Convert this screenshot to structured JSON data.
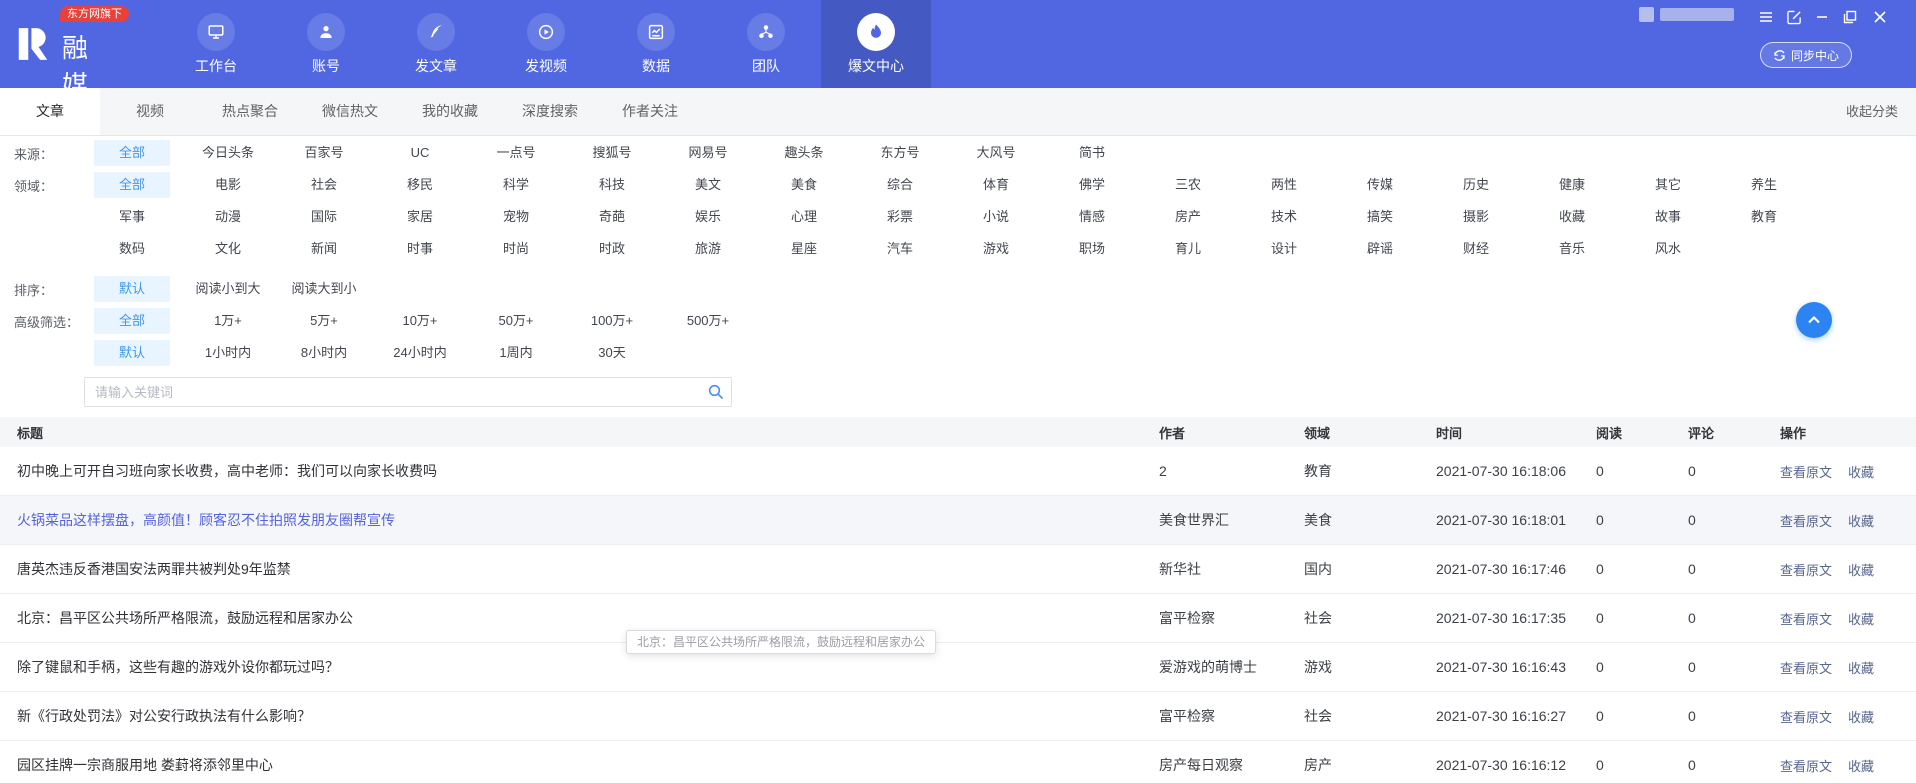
{
  "topbar": {
    "badge": "东方网旗下",
    "brand": "融媒宝",
    "nav": [
      {
        "label": "工作台"
      },
      {
        "label": "账号"
      },
      {
        "label": "发文章"
      },
      {
        "label": "发视频"
      },
      {
        "label": "数据"
      },
      {
        "label": "团队"
      },
      {
        "label": "爆文中心",
        "active": true
      }
    ],
    "sync_button": "同步中心"
  },
  "tabbar": {
    "tabs": [
      "文章",
      "视频",
      "热点聚合",
      "微信热文",
      "我的收藏",
      "深度搜索",
      "作者关注"
    ],
    "active_tab": "文章",
    "collapse": "收起分类"
  },
  "filters": {
    "source": {
      "label": "来源：",
      "selected": "全部",
      "options": [
        "全部",
        "今日头条",
        "百家号",
        "UC",
        "一点号",
        "搜狐号",
        "网易号",
        "趣头条",
        "东方号",
        "大风号",
        "简书"
      ]
    },
    "domain": {
      "label": "领域：",
      "selected": "全部",
      "rows": [
        [
          "全部",
          "电影",
          "社会",
          "移民",
          "科学",
          "科技",
          "美文",
          "美食",
          "综合",
          "体育",
          "佛学",
          "三农",
          "两性",
          "传媒",
          "历史",
          "健康",
          "其它",
          "养生"
        ],
        [
          "军事",
          "动漫",
          "国际",
          "家居",
          "宠物",
          "奇葩",
          "娱乐",
          "心理",
          "彩票",
          "小说",
          "情感",
          "房产",
          "技术",
          "搞笑",
          "摄影",
          "收藏",
          "故事",
          "教育"
        ],
        [
          "数码",
          "文化",
          "新闻",
          "时事",
          "时尚",
          "时政",
          "旅游",
          "星座",
          "汽车",
          "游戏",
          "职场",
          "育儿",
          "设计",
          "辟谣",
          "财经",
          "音乐",
          "风水"
        ]
      ]
    },
    "sort": {
      "label": "排序：",
      "selected": "默认",
      "options": [
        "默认",
        "阅读小到大",
        "阅读大到小"
      ]
    },
    "advanced": {
      "label": "高级筛选：",
      "read_selected": "全部",
      "read_options": [
        "全部",
        "1万+",
        "5万+",
        "10万+",
        "50万+",
        "100万+",
        "500万+"
      ],
      "time_selected": "默认",
      "time_options": [
        "默认",
        "1小时内",
        "8小时内",
        "24小时内",
        "1周内",
        "30天"
      ]
    },
    "search": {
      "placeholder": "请输入关键词"
    }
  },
  "table": {
    "headers": {
      "title": "标题",
      "author": "作者",
      "domain": "领域",
      "time": "时间",
      "reads": "阅读",
      "comments": "评论",
      "actions": "操作"
    },
    "row_actions": {
      "view": "查看原文",
      "fav": "收藏"
    },
    "rows": [
      {
        "title": "初中晚上可开自习班向家长收费，高中老师：我们可以向家长收费吗",
        "author": "2",
        "domain": "教育",
        "time": "2021-07-30 16:18:06",
        "reads": "0",
        "comments": "0"
      },
      {
        "title": "火锅菜品这样摆盘，高颜值！顾客忍不住拍照发朋友圈帮宣传",
        "author": "美食世界汇",
        "domain": "美食",
        "time": "2021-07-30 16:18:01",
        "reads": "0",
        "comments": "0",
        "blue": true,
        "hl": true
      },
      {
        "title": "唐英杰违反香港国安法两罪共被判处9年监禁",
        "author": "新华社",
        "domain": "国内",
        "time": "2021-07-30 16:17:46",
        "reads": "0",
        "comments": "0"
      },
      {
        "title": "北京：昌平区公共场所严格限流，鼓励远程和居家办公",
        "author": "富平检察",
        "domain": "社会",
        "time": "2021-07-30 16:17:35",
        "reads": "0",
        "comments": "0"
      },
      {
        "title": "除了键鼠和手柄，这些有趣的游戏外设你都玩过吗？",
        "author": "爱游戏的萌博士",
        "domain": "游戏",
        "time": "2021-07-30 16:16:43",
        "reads": "0",
        "comments": "0"
      },
      {
        "title": "新《行政处罚法》对公安行政执法有什么影响？",
        "author": "富平检察",
        "domain": "社会",
        "time": "2021-07-30 16:16:27",
        "reads": "0",
        "comments": "0"
      },
      {
        "title": "园区挂牌一宗商服用地 娄葑将添邻里中心",
        "author": "房产每日观察",
        "domain": "房产",
        "time": "2021-07-30 16:16:12",
        "reads": "0",
        "comments": "0"
      }
    ],
    "tooltip": "北京：昌平区公共场所严格限流，鼓励远程和居家办公"
  },
  "colors": {
    "topbar_blue": "#5067e1",
    "badge_red": "#e8413c",
    "chip_selected_text": "#3e97e8",
    "chip_selected_bg": "#e8f4ff",
    "title_link_blue": "#5464d8",
    "fab_blue": "#2c83f2"
  }
}
